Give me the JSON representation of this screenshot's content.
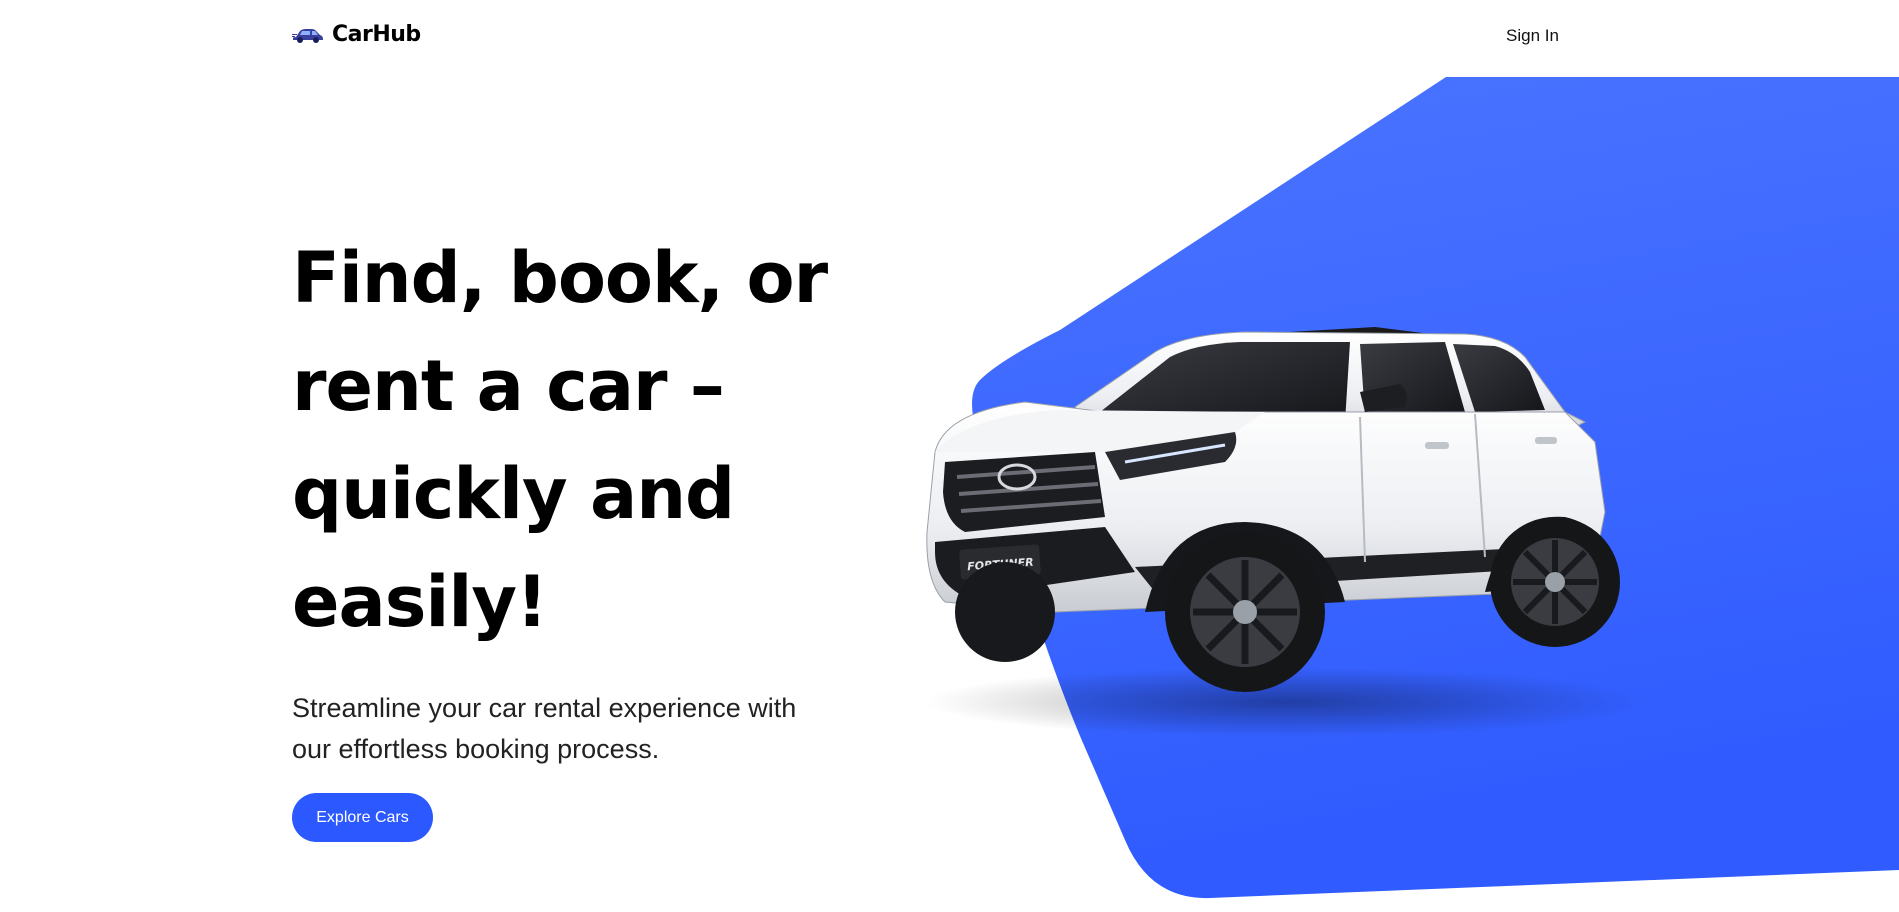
{
  "header": {
    "brand": "CarHub",
    "sign_in_label": "Sign In"
  },
  "hero": {
    "title": "Find, book, or rent a car – quickly and easily!",
    "subtitle": "Streamline your car rental experience with our effortless booking process.",
    "cta_label": "Explore Cars"
  },
  "car": {
    "plate_text": "FORTUNER"
  },
  "colors": {
    "accent": "#2b59ff",
    "accent_light": "#4a74ff",
    "text": "#000000"
  },
  "icons": {
    "logo": "car-icon"
  }
}
